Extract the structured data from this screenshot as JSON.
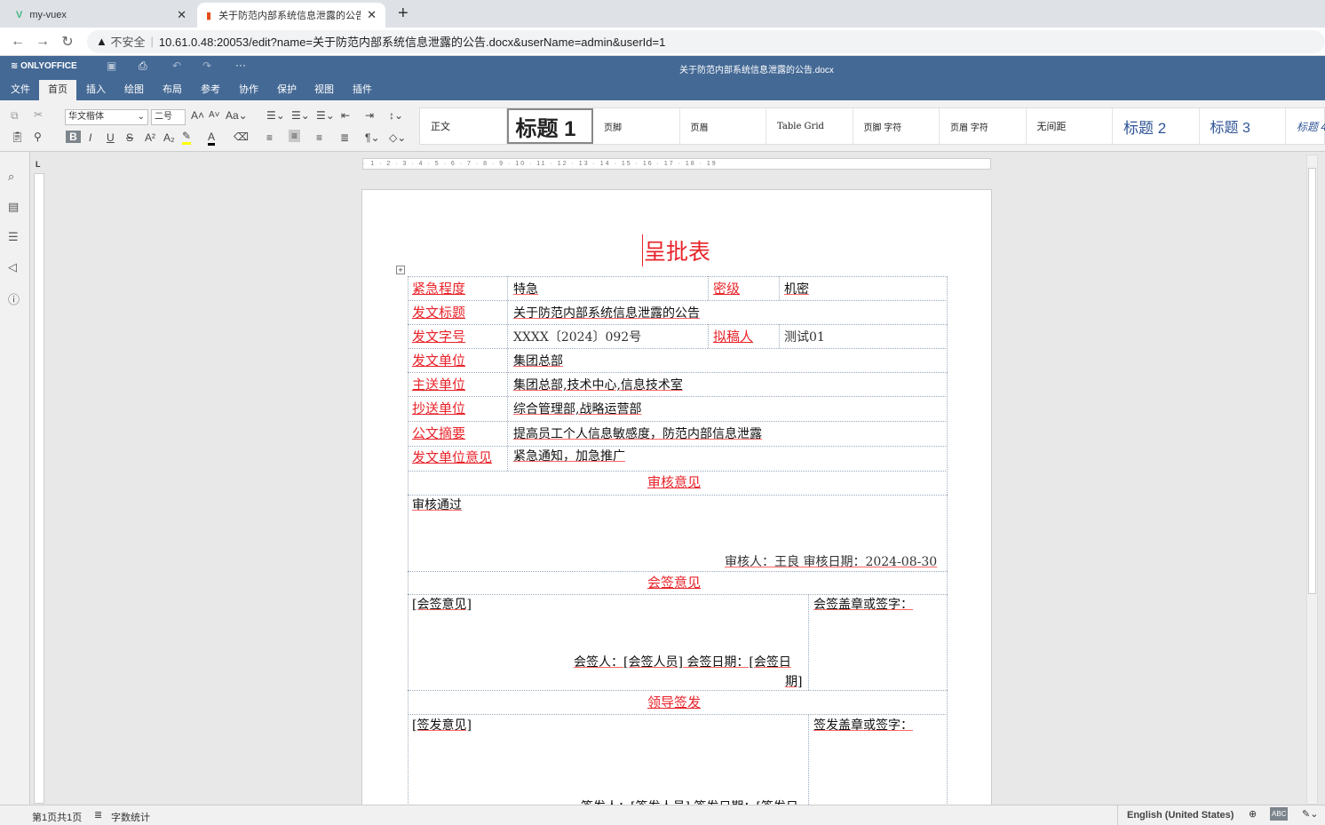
{
  "browser": {
    "tabs": [
      {
        "title": "my-vuex",
        "active": false
      },
      {
        "title": "关于防范内部系统信息泄露的公告",
        "active": true
      }
    ],
    "security": "不安全",
    "url": "10.61.0.48:20053/edit?name=关于防范内部系统信息泄露的公告.docx&userName=admin&userId=1"
  },
  "app": {
    "brand": "ONLYOFFICE",
    "doc_title": "关于防范内部系统信息泄露的公告.docx",
    "menus": [
      "文件",
      "首页",
      "插入",
      "绘图",
      "布局",
      "参考",
      "协作",
      "保护",
      "视图",
      "插件"
    ],
    "active_menu": "首页",
    "header_color": "#446995"
  },
  "toolbar": {
    "font": "华文楷体",
    "size": "二号",
    "styles": [
      "正文",
      "标题 1",
      "页脚",
      "页眉",
      "Table Grid",
      "页脚 字符",
      "页眉 字符",
      "无间距",
      "标题 2",
      "标题 3",
      "标题 4"
    ],
    "ruler": "· 1 · 2 · 3 · 4 · 5 · 6 · 7 · 8 · 9 · 10 · 11 · 12 · 13 · 14 · 15 · 16 · 17 · 18 · 19"
  },
  "document": {
    "title": "呈批表",
    "rows": [
      {
        "label": "紧急程度",
        "value": "特急",
        "label2": "密级",
        "value2": "机密"
      },
      {
        "label": "发文标题",
        "value": "关于防范内部系统信息泄露的公告"
      },
      {
        "label": "发文字号",
        "value": "XXXX〔2024〕092号",
        "label2": "拟稿人",
        "value2": "测试01"
      },
      {
        "label": "发文单位",
        "value": "集团总部"
      },
      {
        "label": "主送单位",
        "value": "集团总部,技术中心,信息技术室"
      },
      {
        "label": "抄送单位",
        "value": "综合管理部,战略运营部"
      },
      {
        "label": "公文摘要",
        "value": "提高员工个人信息敏感度，防范内部信息泄露"
      },
      {
        "label": "发文单位意见",
        "value": "紧急通知，加急推广"
      }
    ],
    "review": {
      "heading": "审核意见",
      "text": "审核通过",
      "signer": "审核人：王良  审核日期：2024-08-30"
    },
    "countersign": {
      "heading": "会签意见",
      "text": "[会签意见]",
      "seal": "会签盖章或签字：",
      "signer": "会签人：[会签人员]   会签日期：[会签日",
      "signer2": "期]"
    },
    "leader": {
      "heading": "领导签发",
      "text": "[签发意见]",
      "seal": "签发盖章或签字：",
      "signer": "签发人：[签发人员] 签发日期：[签发日"
    }
  },
  "status": {
    "page": "第1页共1页",
    "word_count": "字数统计",
    "language": "English (United States)"
  }
}
